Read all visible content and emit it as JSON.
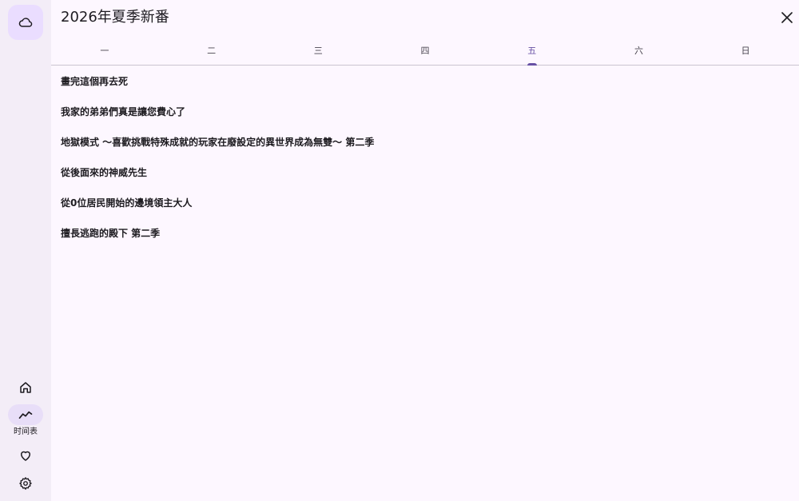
{
  "window": {
    "title": "2026年夏季新番"
  },
  "rail": {
    "top_button_icon": "cloud-icon",
    "items": [
      {
        "icon": "home-icon",
        "label": "",
        "active": false
      },
      {
        "icon": "timeline-icon",
        "label": "时间表",
        "active": true
      },
      {
        "icon": "heart-icon",
        "label": "",
        "active": false
      },
      {
        "icon": "gear-icon",
        "label": "",
        "active": false
      }
    ]
  },
  "tabs": [
    {
      "label": "一",
      "active": false
    },
    {
      "label": "二",
      "active": false
    },
    {
      "label": "三",
      "active": false
    },
    {
      "label": "四",
      "active": false
    },
    {
      "label": "五",
      "active": true
    },
    {
      "label": "六",
      "active": false
    },
    {
      "label": "日",
      "active": false
    }
  ],
  "anime_list": [
    "畫完這個再去死",
    "我家的弟弟們真是讓您費心了",
    "地獄模式 ～喜歡挑戰特殊成就的玩家在廢設定的異世界成為無雙～ 第二季",
    "從後面來的神威先生",
    "從0位居民開始的邊境領主大人",
    "擅長逃跑的殿下 第二季"
  ],
  "colors": {
    "accent": "#6750a4",
    "rail_background": "#f3edf7",
    "active_indicator": "#e8def8",
    "top_button_background": "#eaddff",
    "page_background": "#fdf7ff"
  }
}
